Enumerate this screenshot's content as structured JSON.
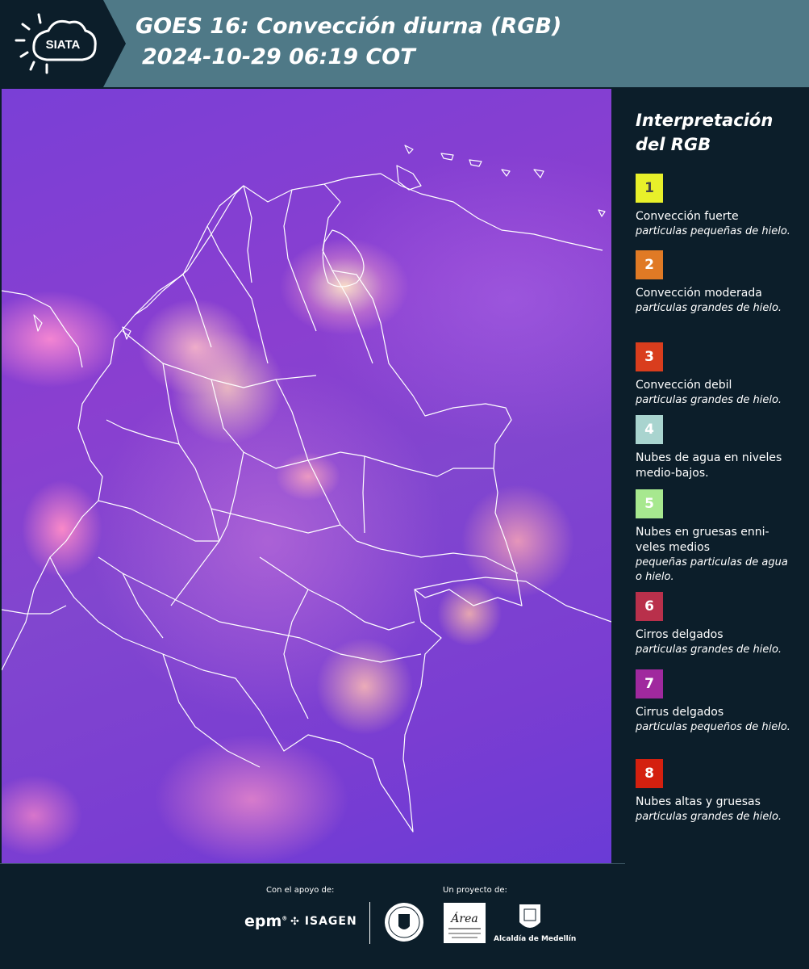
{
  "header": {
    "logo_text": "SIATA",
    "title_line1": "GOES 16: Convección diurna (RGB)",
    "title_line2": "2024-10-29 06:19 COT"
  },
  "map": {
    "description_icon": "satellite-rgb-map"
  },
  "legend": {
    "title_line1": "Interpretación",
    "title_line2": "del RGB",
    "items": [
      {
        "number": "1",
        "color": "#e8f02a",
        "text_color": "#444444",
        "label": "Convección fuerte",
        "desc": "particulas pequeñas de hielo."
      },
      {
        "number": "2",
        "color": "#e07a25",
        "text_color": "#ffffff",
        "label": "Convección moderada",
        "desc": "particulas grandes de hielo."
      },
      {
        "number": "3",
        "color": "#d93d1d",
        "text_color": "#ffffff",
        "label": "Convección debil",
        "desc": "particulas grandes de hielo."
      },
      {
        "number": "4",
        "color": "#a9d4cf",
        "text_color": "#ffffff",
        "label": "Nubes de agua en niveles medio-bajos.",
        "desc": ""
      },
      {
        "number": "5",
        "color": "#a7e88f",
        "text_color": "#ffffff",
        "label": "Nubes en gruesas enni-veles medios",
        "desc": "pequeñas particulas de agua o hielo."
      },
      {
        "number": "6",
        "color": "#b9304b",
        "text_color": "#ffffff",
        "label": "Cirros delgados",
        "desc": "particulas grandes de hielo."
      },
      {
        "number": "7",
        "color": "#a0299e",
        "text_color": "#ffffff",
        "label": "Cirrus delgados",
        "desc": "particulas pequeños de hielo."
      },
      {
        "number": "8",
        "color": "#d4200f",
        "text_color": "#ffffff",
        "label": "Nubes altas y gruesas",
        "desc": "particulas grandes de hielo."
      }
    ]
  },
  "footer": {
    "support_label": "Con el apoyo de:",
    "project_label": "Un proyecto de:",
    "epm_text": "epm",
    "isagen_text": "ISAGEN",
    "area_text": "Área",
    "alcaldia_text": "Alcaldía de Medellín"
  }
}
